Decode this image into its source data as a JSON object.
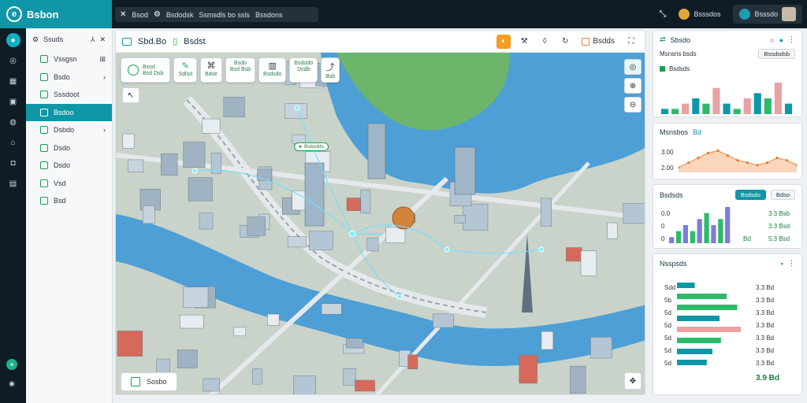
{
  "topbar": {
    "brand": "Bsbon",
    "path": [
      "Bsod",
      "Bsdodsk",
      "Ssmsdls bo ssls",
      "Bssdons"
    ],
    "user_a": "Bsssdos",
    "user_b": "Bsssdo"
  },
  "sidebar": {
    "header": "Ssuds",
    "items": [
      {
        "label": "Vssgsn",
        "arrow": "⊞",
        "active": false
      },
      {
        "label": "Bsdo",
        "arrow": "›",
        "active": false
      },
      {
        "label": "Sssdoot",
        "arrow": "",
        "active": false
      },
      {
        "label": "Bsdoo",
        "arrow": "",
        "active": true
      },
      {
        "label": "Dsbdo",
        "arrow": "›",
        "active": false
      },
      {
        "label": "Dsdo",
        "arrow": "",
        "active": false
      },
      {
        "label": "Dsdo",
        "arrow": "",
        "active": false
      },
      {
        "label": "Vsd",
        "arrow": "",
        "active": false
      },
      {
        "label": "Bsd",
        "arrow": "",
        "active": false
      }
    ]
  },
  "map": {
    "title": "Sbd.Bo",
    "title2": "Bsdst",
    "toolbar_pill": "Bsdds",
    "layers": [
      {
        "top": "Bsod",
        "bottom": "Bsd Dsb"
      },
      {
        "top": "",
        "bottom": "Sdlsd"
      },
      {
        "top": "",
        "bottom": "Bdse"
      },
      {
        "top": "Bsdo",
        "bottom": "Bsd Bsb"
      },
      {
        "top": "",
        "bottom": "Bsdsdo"
      },
      {
        "top": "Bsdodo",
        "bottom": "Dsdb"
      },
      {
        "top": "",
        "bottom": "Bsb"
      }
    ],
    "legend": "Sosbo",
    "marker": "Bsbsdds"
  },
  "panels": {
    "p1": {
      "title": "Sbsdo",
      "sub_title": "Msnsns bsds",
      "pill": "Bssdsdsb",
      "legend": "Bsdsds"
    },
    "p2": {
      "title": "Msnsbos",
      "badge": "Bd",
      "y_top": "3.00",
      "y_bottom": "2.00"
    },
    "p3": {
      "title": "Bsdsds",
      "pill_a": "Bsdsdo",
      "pill_b": "Bdso",
      "left": [
        "0.0",
        "0",
        "0"
      ],
      "right": [
        "3.3 Bsb",
        "3.3 Bsd",
        "5.3 Bsd"
      ],
      "bottom_left": "Bd"
    },
    "p4": {
      "title": "Nsspsds",
      "rows": [
        {
          "label": "Sdd",
          "value": "3.3 Bd"
        },
        {
          "label": "5b",
          "value": "3.3 Bd"
        },
        {
          "label": "5d",
          "value": "3.3 Bd"
        },
        {
          "label": "5d",
          "value": "3.3 Bd"
        },
        {
          "label": "5d",
          "value": "3.3 Bd"
        },
        {
          "label": "5d",
          "value": "3.3 Bd"
        },
        {
          "label": "5d",
          "value": "3.3 Bd"
        }
      ],
      "total": "3.9 Bd"
    }
  },
  "chart_data": [
    {
      "type": "bar",
      "values": [
        1,
        1,
        2,
        3,
        2,
        5,
        2,
        1,
        3,
        4,
        3,
        6,
        2
      ],
      "ylim": [
        0,
        6
      ],
      "colors": [
        "#0f97a7",
        "#2dbb6b",
        "#e8a2a2"
      ]
    },
    {
      "type": "area",
      "values": [
        0.2,
        0.4,
        0.6,
        0.8,
        0.9,
        0.7,
        0.5,
        0.4,
        0.3,
        0.4,
        0.6,
        0.5,
        0.3
      ],
      "ylim": [
        0,
        1
      ],
      "color": "#f3a56a"
    },
    {
      "type": "bar",
      "values": [
        1,
        2,
        3,
        2,
        4,
        5,
        3,
        4,
        6
      ],
      "ylim": [
        0,
        6
      ],
      "colors": [
        "#7c7ed8",
        "#2dbb6b"
      ]
    },
    {
      "type": "bar",
      "orientation": "horizontal",
      "values": [
        0.25,
        0.7,
        0.85,
        0.6,
        0.9,
        0.62,
        0.5,
        0.42
      ],
      "xlim": [
        0,
        1
      ],
      "colors": [
        "#0f97a7",
        "#2dbb6b",
        "#2dbb6b",
        "#0f97a7",
        "#f0a0a0",
        "#2dbb6b",
        "#0f97a7",
        "#0f97a7"
      ]
    }
  ]
}
